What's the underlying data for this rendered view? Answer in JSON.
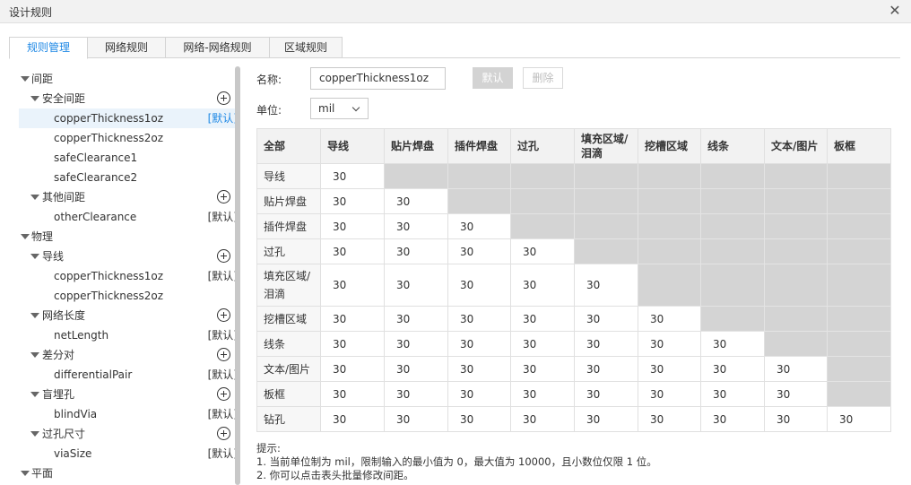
{
  "window": {
    "title": "设计规则"
  },
  "tabs": [
    {
      "label": "规则管理",
      "active": true
    },
    {
      "label": "网络规则",
      "active": false
    },
    {
      "label": "网络-网络规则",
      "active": false
    },
    {
      "label": "区域规则",
      "active": false
    }
  ],
  "tree": {
    "default_label": "[默认]",
    "items": [
      {
        "label": "间距"
      },
      {
        "label": "安全间距"
      },
      {
        "label": "copperThickness1oz"
      },
      {
        "label": "copperThickness2oz"
      },
      {
        "label": "safeClearance1"
      },
      {
        "label": "safeClearance2"
      },
      {
        "label": "其他间距"
      },
      {
        "label": "otherClearance"
      },
      {
        "label": "物理"
      },
      {
        "label": "导线"
      },
      {
        "label": "copperThickness1oz"
      },
      {
        "label": "copperThickness2oz"
      },
      {
        "label": "网络长度"
      },
      {
        "label": "netLength"
      },
      {
        "label": "差分对"
      },
      {
        "label": "differentialPair"
      },
      {
        "label": "盲埋孔"
      },
      {
        "label": "blindVia"
      },
      {
        "label": "过孔尺寸"
      },
      {
        "label": "viaSize"
      },
      {
        "label": "平面"
      }
    ]
  },
  "form": {
    "name_label": "名称:",
    "name_value": "copperThickness1oz",
    "unit_label": "单位:",
    "unit_value": "mil",
    "default_button": "默认",
    "delete_button": "删除"
  },
  "table": {
    "corner": "全部",
    "columns": [
      "导线",
      "贴片焊盘",
      "插件焊盘",
      "过孔",
      "填充区域/泪滴",
      "挖槽区域",
      "线条",
      "文本/图片",
      "板框"
    ],
    "rows": [
      {
        "label": "导线",
        "values": [
          "30"
        ]
      },
      {
        "label": "贴片焊盘",
        "values": [
          "30",
          "30"
        ]
      },
      {
        "label": "插件焊盘",
        "values": [
          "30",
          "30",
          "30"
        ]
      },
      {
        "label": "过孔",
        "values": [
          "30",
          "30",
          "30",
          "30"
        ]
      },
      {
        "label": "填充区域/泪滴",
        "values": [
          "30",
          "30",
          "30",
          "30",
          "30"
        ]
      },
      {
        "label": "挖槽区域",
        "values": [
          "30",
          "30",
          "30",
          "30",
          "30",
          "30"
        ]
      },
      {
        "label": "线条",
        "values": [
          "30",
          "30",
          "30",
          "30",
          "30",
          "30",
          "30"
        ]
      },
      {
        "label": "文本/图片",
        "values": [
          "30",
          "30",
          "30",
          "30",
          "30",
          "30",
          "30",
          "30"
        ]
      },
      {
        "label": "板框",
        "values": [
          "30",
          "30",
          "30",
          "30",
          "30",
          "30",
          "30",
          "30"
        ]
      },
      {
        "label": "钻孔",
        "values": [
          "30",
          "30",
          "30",
          "30",
          "30",
          "30",
          "30",
          "30",
          "30"
        ]
      }
    ]
  },
  "hint": {
    "title": "提示:",
    "line1": "1. 当前单位制为 mil，限制输入的最小值为 0，最大值为 10000，且小数位仅限 1 位。",
    "line2": "2. 你可以点击表头批量修改间距。"
  },
  "colors": {
    "accent": "#1e88e5",
    "disabled_cell": "#d4d4d4",
    "selected_row": "#eaf3fb"
  },
  "icons": {
    "close": "close-icon",
    "expand": "caret-down-icon",
    "add": "plus-circle-icon",
    "select": "chevron-down-icon"
  }
}
